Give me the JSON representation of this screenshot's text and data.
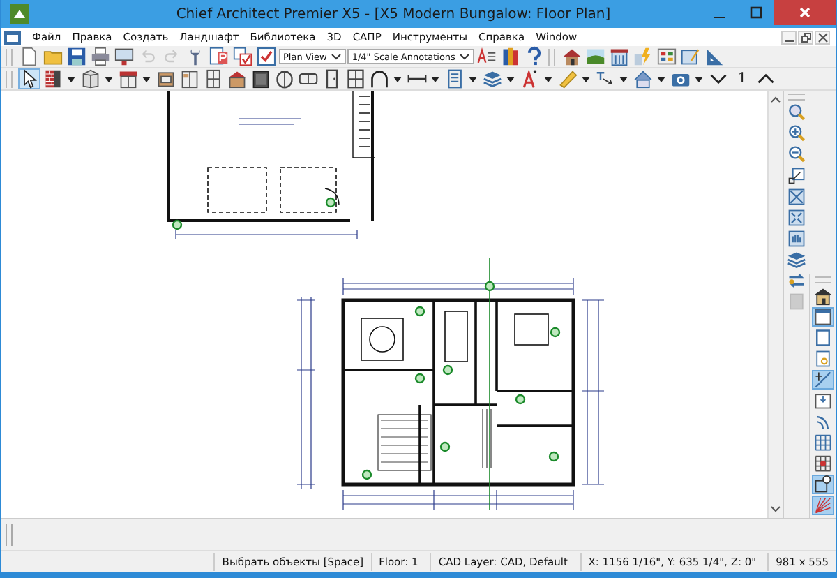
{
  "window": {
    "title": "Chief Architect Premier X5 - [X5 Modern Bungalow: Floor Plan]"
  },
  "menu": [
    "Файл",
    "Правка",
    "Создать",
    "Ландшафт",
    "Библиотека",
    "3D",
    "САПР",
    "Инструменты",
    "Справка",
    "Window"
  ],
  "toolbar_1": [
    {
      "kind": "button",
      "disabled": false
    },
    {
      "kind": "button",
      "disabled": false
    },
    {
      "kind": "button",
      "disabled": false
    },
    {
      "kind": "button",
      "disabled": false
    },
    {
      "kind": "button",
      "disabled": false
    },
    {
      "kind": "button",
      "disabled": true
    },
    {
      "kind": "button",
      "disabled": true
    },
    {
      "kind": "button",
      "disabled": false
    },
    {
      "kind": "button",
      "disabled": false
    },
    {
      "kind": "button",
      "disabled": false
    },
    {
      "kind": "button",
      "disabled": false
    },
    {
      "kind": "select",
      "value": "Plan View",
      "disabled": false
    },
    {
      "kind": "select",
      "value": "1/4\" Scale Annotations",
      "disabled": false
    },
    {
      "kind": "button",
      "disabled": false
    },
    {
      "kind": "button",
      "disabled": false
    },
    {
      "kind": "button",
      "disabled": false
    },
    {
      "kind": "separator",
      "disabled": false
    },
    {
      "kind": "button",
      "disabled": false
    },
    {
      "kind": "button",
      "disabled": false
    },
    {
      "kind": "button",
      "disabled": false
    },
    {
      "kind": "button",
      "disabled": false
    },
    {
      "kind": "button",
      "disabled": false
    },
    {
      "kind": "button",
      "disabled": false
    },
    {
      "kind": "button",
      "disabled": false
    }
  ],
  "toolbar_2": [
    {
      "kind": "button",
      "selected": true
    },
    {
      "kind": "dropdown",
      "selected": false
    },
    {
      "kind": "dropdown",
      "selected": false
    },
    {
      "kind": "dropdown",
      "selected": false
    },
    {
      "kind": "button",
      "selected": false
    },
    {
      "kind": "button",
      "selected": false
    },
    {
      "kind": "button",
      "selected": false
    },
    {
      "kind": "button",
      "selected": false
    },
    {
      "kind": "button",
      "selected": false
    },
    {
      "kind": "button",
      "selected": false
    },
    {
      "kind": "button",
      "selected": false
    },
    {
      "kind": "button",
      "selected": false
    },
    {
      "kind": "button",
      "selected": false
    },
    {
      "kind": "dropdown",
      "selected": false
    },
    {
      "kind": "dropdown",
      "selected": false
    },
    {
      "kind": "dropdown",
      "selected": false
    },
    {
      "kind": "dropdown",
      "selected": false
    },
    {
      "kind": "dropdown",
      "selected": false
    },
    {
      "kind": "dropdown",
      "selected": false
    },
    {
      "kind": "dropdown",
      "selected": false
    },
    {
      "kind": "dropdown",
      "selected": false
    },
    {
      "kind": "dropdown",
      "selected": false
    },
    {
      "kind": "button",
      "selected": false
    },
    {
      "kind": "label",
      "text": "1",
      "selected": false
    },
    {
      "kind": "button",
      "selected": false
    }
  ],
  "right_toolbar_1": [
    {
      "selected": false
    },
    {
      "selected": false
    },
    {
      "selected": false
    },
    {
      "selected": false
    },
    {
      "selected": false
    },
    {
      "selected": false
    },
    {
      "selected": false
    },
    {
      "selected": false
    },
    {
      "selected": false
    },
    {
      "selected": false
    }
  ],
  "right_toolbar_2": [
    {
      "selected": false
    },
    {
      "selected": true
    },
    {
      "selected": false
    },
    {
      "selected": false
    },
    {
      "selected": true
    },
    {
      "selected": false
    },
    {
      "selected": false
    },
    {
      "selected": false
    },
    {
      "selected": false
    },
    {
      "selected": true
    },
    {
      "selected": true
    }
  ],
  "status_bar": [
    "Выбрать объекты [Space]",
    "Floor: 1",
    "CAD Layer: CAD,  Default",
    "X: 1156 1/16\", Y: 635 1/4\", Z: 0\"",
    "981 x 555"
  ]
}
